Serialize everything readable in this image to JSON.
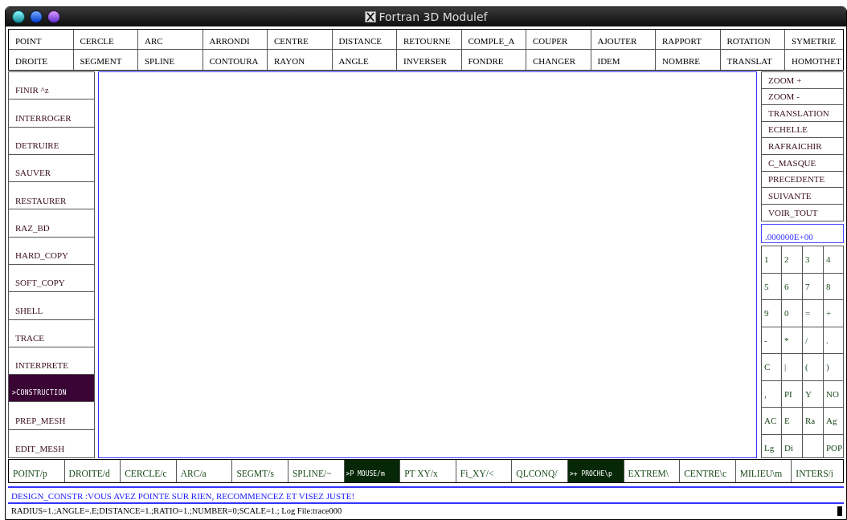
{
  "window": {
    "title": "Fortran 3D Modulef"
  },
  "menu_rows": [
    [
      "POINT",
      "CERCLE",
      "ARC",
      "ARRONDI",
      "CENTRE",
      "DISTANCE",
      "RETOURNE",
      "COMPLE_A",
      "COUPER",
      "AJOUTER",
      "RAPPORT",
      "ROTATION",
      "SYMETRIE"
    ],
    [
      "DROITE",
      "SEGMENT",
      "SPLINE",
      "CONTOURA",
      "RAYON",
      "ANGLE",
      "INVERSER",
      "FONDRE",
      "CHANGER",
      "IDEM",
      "NOMBRE",
      "TRANSLAT",
      "HOMOTHET"
    ]
  ],
  "sidebar": {
    "items": [
      {
        "label": "FINIR ^z",
        "selected": false
      },
      {
        "label": "INTERROGER",
        "selected": false
      },
      {
        "label": "DETRUIRE",
        "selected": false
      },
      {
        "label": "SAUVER",
        "selected": false
      },
      {
        "label": "RESTAURER",
        "selected": false
      },
      {
        "label": "RAZ_BD",
        "selected": false
      },
      {
        "label": "HARD_COPY",
        "selected": false
      },
      {
        "label": "SOFT_COPY",
        "selected": false
      },
      {
        "label": "SHELL",
        "selected": false
      },
      {
        "label": "TRACE",
        "selected": false
      },
      {
        "label": "INTERPRETE",
        "selected": false
      },
      {
        "label": ">CONSTRUCTION",
        "selected": true
      },
      {
        "label": "PREP_MESH",
        "selected": false
      },
      {
        "label": "EDIT_MESH",
        "selected": false
      }
    ]
  },
  "view_buttons": [
    "ZOOM +",
    "ZOOM -",
    "TRANSLATION",
    "ECHELLE",
    "RAFRAICHIR",
    "C_MASQUE",
    "PRECEDENTE",
    "SUIVANTE",
    "VOIR_TOUT"
  ],
  "value_field": {
    "value": ".000000E+00"
  },
  "keypad": [
    [
      "1",
      "2",
      "3",
      "4"
    ],
    [
      "5",
      "6",
      "7",
      "8"
    ],
    [
      "9",
      "0",
      "=",
      "+"
    ],
    [
      "-",
      "*",
      "/",
      "."
    ],
    [
      "C",
      "|",
      "(",
      ")"
    ],
    [
      ",",
      "PI",
      "Y",
      "NO"
    ],
    [
      "AC",
      "E",
      "Ra",
      "Ag"
    ],
    [
      "Lg",
      "Di",
      {
        "kind": "blank"
      },
      "POP"
    ]
  ],
  "mode_bar": [
    {
      "label": "POINT/p",
      "selected": false
    },
    {
      "label": "DROITE/d",
      "selected": false
    },
    {
      "label": "CERCLE/c",
      "selected": false
    },
    {
      "label": "ARC/a",
      "selected": false
    },
    {
      "label": "SEGMT/s",
      "selected": false
    },
    {
      "label": "SPLINE/~",
      "selected": false
    },
    {
      "label": ">P MOUSE/m",
      "selected": true
    },
    {
      "label": "PT XY/x",
      "selected": false
    },
    {
      "label": "Fi_XY/<",
      "selected": false
    },
    {
      "label": "QLCONQ/",
      "selected": false
    },
    {
      "label": ">+ PROCHE\\p",
      "selected": true
    },
    {
      "label": "EXTREM\\",
      "selected": false
    },
    {
      "label": "CENTRE\\c",
      "selected": false
    },
    {
      "label": "MILIEU\\m",
      "selected": false
    },
    {
      "label": "INTERS/i",
      "selected": false
    }
  ],
  "message": "DESIGN_CONSTR :VOUS AVEZ POINTE SUR RIEN, RECOMMENCEZ ET VISEZ JUSTE!",
  "status_bar": "RADIUS=1.;ANGLE=.E;DISTANCE=1.;RATIO=1.;NUMBER=0;SCALE=1.; Log File:trace000"
}
